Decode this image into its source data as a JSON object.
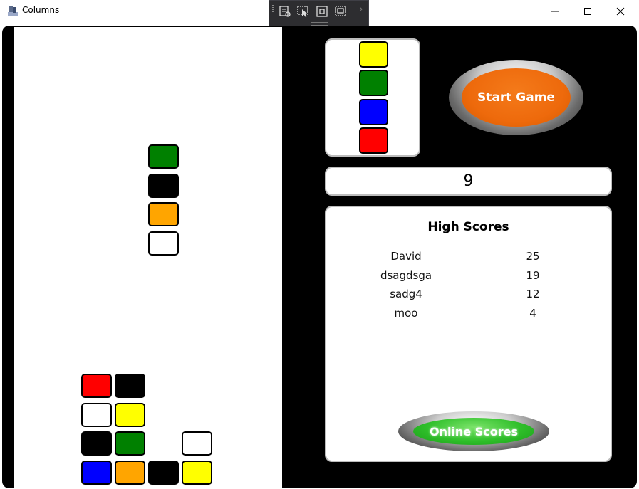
{
  "window": {
    "title": "Columns",
    "minimize_glyph": "—",
    "maximize_glyph": "☐",
    "close_glyph": "✕"
  },
  "colors": {
    "red": "#ff0000",
    "black": "#000000",
    "white": "#ffffff",
    "yellow": "#ffff00",
    "green": "#008000",
    "blue": "#0000ff",
    "orange": "#ffa500"
  },
  "game": {
    "falling_piece": [
      "green",
      "black",
      "orange",
      "white"
    ],
    "next_piece": [
      "yellow",
      "green",
      "blue",
      "red"
    ],
    "score": "9",
    "start_label": "Start Game",
    "online_label": "Online Scores"
  },
  "high_scores": {
    "title": "High Scores",
    "entries": [
      {
        "name": "David",
        "score": "25"
      },
      {
        "name": "dsagdsga",
        "score": "19"
      },
      {
        "name": "sadg4",
        "score": "12"
      },
      {
        "name": "moo",
        "score": "4"
      }
    ]
  }
}
